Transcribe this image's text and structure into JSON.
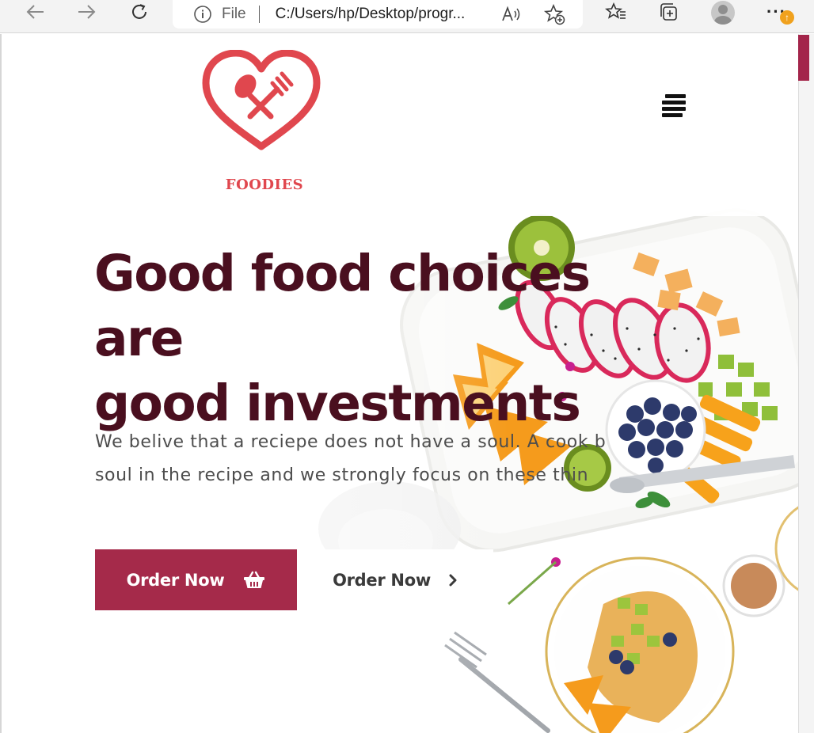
{
  "browser": {
    "file_label": "File",
    "url": "C:/Users/hp/Desktop/progr...",
    "update_badge": "↑",
    "more_label": "···"
  },
  "site": {
    "brand": "FOODIES",
    "hero": {
      "headline_line1": "Good food choices are",
      "headline_line2": "good investments",
      "subtext_line1": "We belive that a reciepe does not have a soul. A cook b",
      "subtext_line2": "soul in the recipe and we strongly focus on these thin",
      "primary_button": "Order Now",
      "secondary_button": "Order Now"
    }
  },
  "colors": {
    "brand_red": "#e0474e",
    "headline": "#4a0f1f",
    "primary_button": "#a52a4a",
    "scroll_thumb": "#a3254a"
  },
  "icons": {
    "back": "arrow-left-icon",
    "forward": "arrow-right-icon",
    "reload": "reload-icon",
    "info": "info-icon",
    "read_aloud": "read-aloud-icon",
    "add_favorite": "star-plus-icon",
    "favorites": "favorites-list-icon",
    "collections": "collections-icon",
    "menu": "hamburger-icon",
    "basket": "basket-icon",
    "chevron": "chevron-right-icon"
  }
}
